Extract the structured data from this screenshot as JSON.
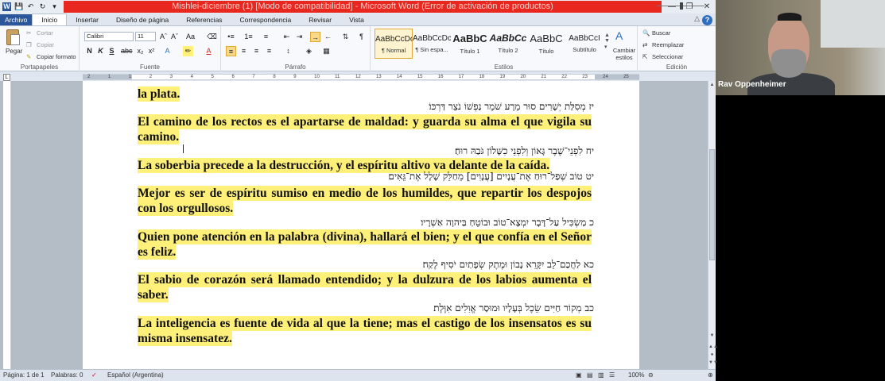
{
  "window": {
    "title": "Mishlei-diciembre (1) [Modo de compatibilidad] - Microsoft Word (Error de activación de productos)",
    "title_bar_color": "#e8271f"
  },
  "tabs": [
    "Archivo",
    "Inicio",
    "Insertar",
    "Diseño de página",
    "Referencias",
    "Correspondencia",
    "Revisar",
    "Vista"
  ],
  "active_tab": "Inicio",
  "ribbon": {
    "portapapeles": {
      "label": "Portapapeles",
      "paste": "Pegar",
      "cut": "Cortar",
      "copy": "Copiar",
      "format_painter": "Copiar formato"
    },
    "fuente": {
      "label": "Fuente",
      "font_name": "Calibri",
      "font_size": "11",
      "bold": "N",
      "italic": "K",
      "underline": "S"
    },
    "parrafo": {
      "label": "Párrafo"
    },
    "estilos": {
      "label": "Estilos",
      "items": [
        {
          "sample": "AaBbCcDc",
          "name": "¶ Normal"
        },
        {
          "sample": "AaBbCcDc",
          "name": "¶ Sin espa..."
        },
        {
          "sample": "AaBbC",
          "name": "Título 1"
        },
        {
          "sample": "AaBbCc",
          "name": "Título 2"
        },
        {
          "sample": "AaBbC",
          "name": "Título"
        },
        {
          "sample": "AaBbCcI",
          "name": "Subtítulo"
        }
      ],
      "change_styles": "Cambiar estilos"
    },
    "edicion": {
      "label": "Edición",
      "find": "Buscar",
      "replace": "Reemplazar",
      "select": "Seleccionar"
    }
  },
  "ruler_numbers": [
    "2",
    "1",
    "1",
    "2",
    "3",
    "4",
    "5",
    "6",
    "7",
    "8",
    "9",
    "10",
    "11",
    "12",
    "13",
    "14",
    "15",
    "16",
    "17",
    "18",
    "19",
    "20",
    "21",
    "22",
    "23",
    "24",
    "25"
  ],
  "document": {
    "blocks": [
      {
        "type": "es",
        "text": "la plata."
      },
      {
        "type": "he",
        "text": "יז מְסִלַּת יְשָׁרִים סוּר מֵרָע שֹׁמֵר נַפְשׁוֹ נֹצֵר דַּרְכּוֹ׃"
      },
      {
        "type": "es",
        "text": "El camino de los rectos es el apartarse de maldad: y guarda su alma el que vigila su camino."
      },
      {
        "type": "he",
        "text": "יח לִפְנֵי־שֶׁבֶר גָּאוֹן וְלִפְנֵי כִשָּׁלוֹן גֹּבַהּ רוּחַ׃"
      },
      {
        "type": "es",
        "text": "La soberbia precede a la destrucción, y el espíritu altivo va delante de la caída."
      },
      {
        "type": "he",
        "text": "יט טוֹב שְׁפַל־רוּחַ אֶת־עֲנָיִים [עֲנָוִים] מֵחַלֵּק שָׁלָל אֶת־גֵּאִים׃"
      },
      {
        "type": "es",
        "text": "Mejor es ser de espíritu sumiso en medio de los humildes, que repartir los despojos con los orgullosos."
      },
      {
        "type": "he",
        "text": "כ מַשְׂכִּיל עַל־דָּבָר יִמְצָא־טוֹב וּבוֹטֵחַ בַּיהוָה אַשְׁרָיו׃"
      },
      {
        "type": "es",
        "text": "Quien pone atención en la palabra (divina), hallará el bien; y el que confía en el Señor es feliz."
      },
      {
        "type": "he",
        "text": "כא לַחֲכַם־לֵב יִקָּרֵא נָבוֹן וּמֶתֶק שְׂפָתַיִם יֹסִיף לֶקַח׃"
      },
      {
        "type": "es",
        "text": "El sabio de corazón será llamado entendido; y la dulzura de los labios aumenta el saber."
      },
      {
        "type": "he",
        "text": "כב מְקוֹר חַיִּים שֵׂכֶל בְּעָלָיו וּמוּסַר אֱוִלִים אִוֶּלֶת׃"
      },
      {
        "type": "es",
        "text": "La inteligencia es fuente de vida al que la tiene; mas el castigo de los insensatos es su misma insensatez."
      }
    ],
    "highlight_color": "#fff07a"
  },
  "status_bar": {
    "page": "Página: 1 de 1",
    "words": "Palabras: 0",
    "language": "Español (Argentina)",
    "zoom": "100%"
  },
  "webcam": {
    "name": "Rav Oppenheimer"
  }
}
